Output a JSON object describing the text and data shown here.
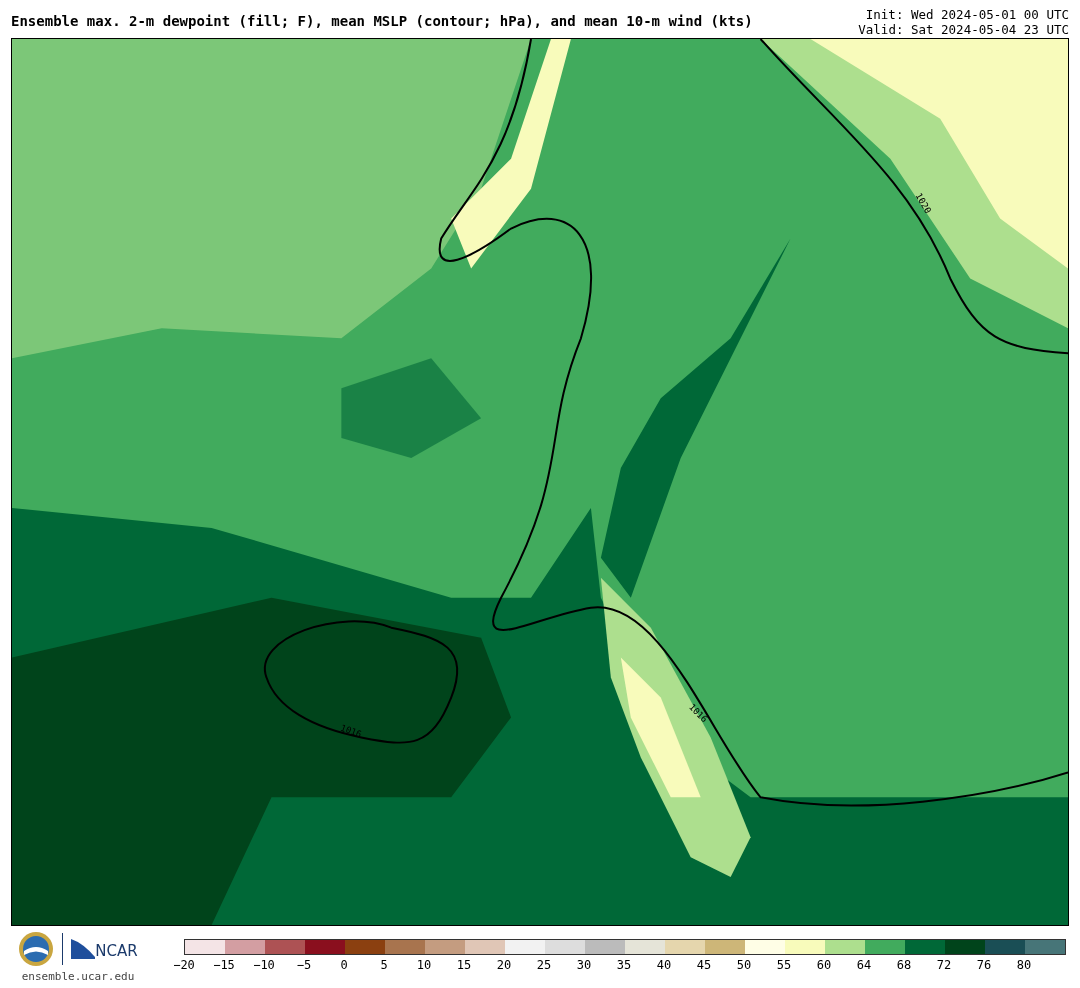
{
  "header": {
    "title": "Ensemble max. 2-m dewpoint (fill; F), mean MSLP (contour; hPa), and mean 10-m wind (kts)",
    "init": "Init: Wed 2024-05-01 00 UTC",
    "valid": "Valid: Sat 2024-05-04 23 UTC"
  },
  "map": {
    "contour_labels": [
      "1020",
      "1016",
      "1016"
    ]
  },
  "footer": {
    "logo_text": "NCAR",
    "url": "ensemble.ucar.edu"
  },
  "colorbar": {
    "bins": [
      {
        "color": "#f4e4e6"
      },
      {
        "color": "#d39ea2"
      },
      {
        "color": "#ad5254"
      },
      {
        "color": "#8a0f1e"
      },
      {
        "color": "#8b4010"
      },
      {
        "color": "#a8744e"
      },
      {
        "color": "#c49c80"
      },
      {
        "color": "#e0c6b6"
      },
      {
        "color": "#f2f2f2"
      },
      {
        "color": "#dddddd"
      },
      {
        "color": "#bbbbbb"
      },
      {
        "color": "#e5e4d8"
      },
      {
        "color": "#e5d6ad"
      },
      {
        "color": "#cdb678"
      },
      {
        "color": "#fffee6"
      },
      {
        "color": "#f8fbbb"
      },
      {
        "color": "#addf8e"
      },
      {
        "color": "#41ab5d"
      },
      {
        "color": "#006837"
      },
      {
        "color": "#00441b"
      },
      {
        "color": "#1a4e55"
      },
      {
        "color": "#477578"
      }
    ],
    "ticks": [
      "−20",
      "−15",
      "−10",
      "−5",
      "0",
      "5",
      "10",
      "15",
      "20",
      "25",
      "30",
      "35",
      "40",
      "45",
      "50",
      "55",
      "60",
      "64",
      "68",
      "72",
      "76",
      "80"
    ]
  }
}
